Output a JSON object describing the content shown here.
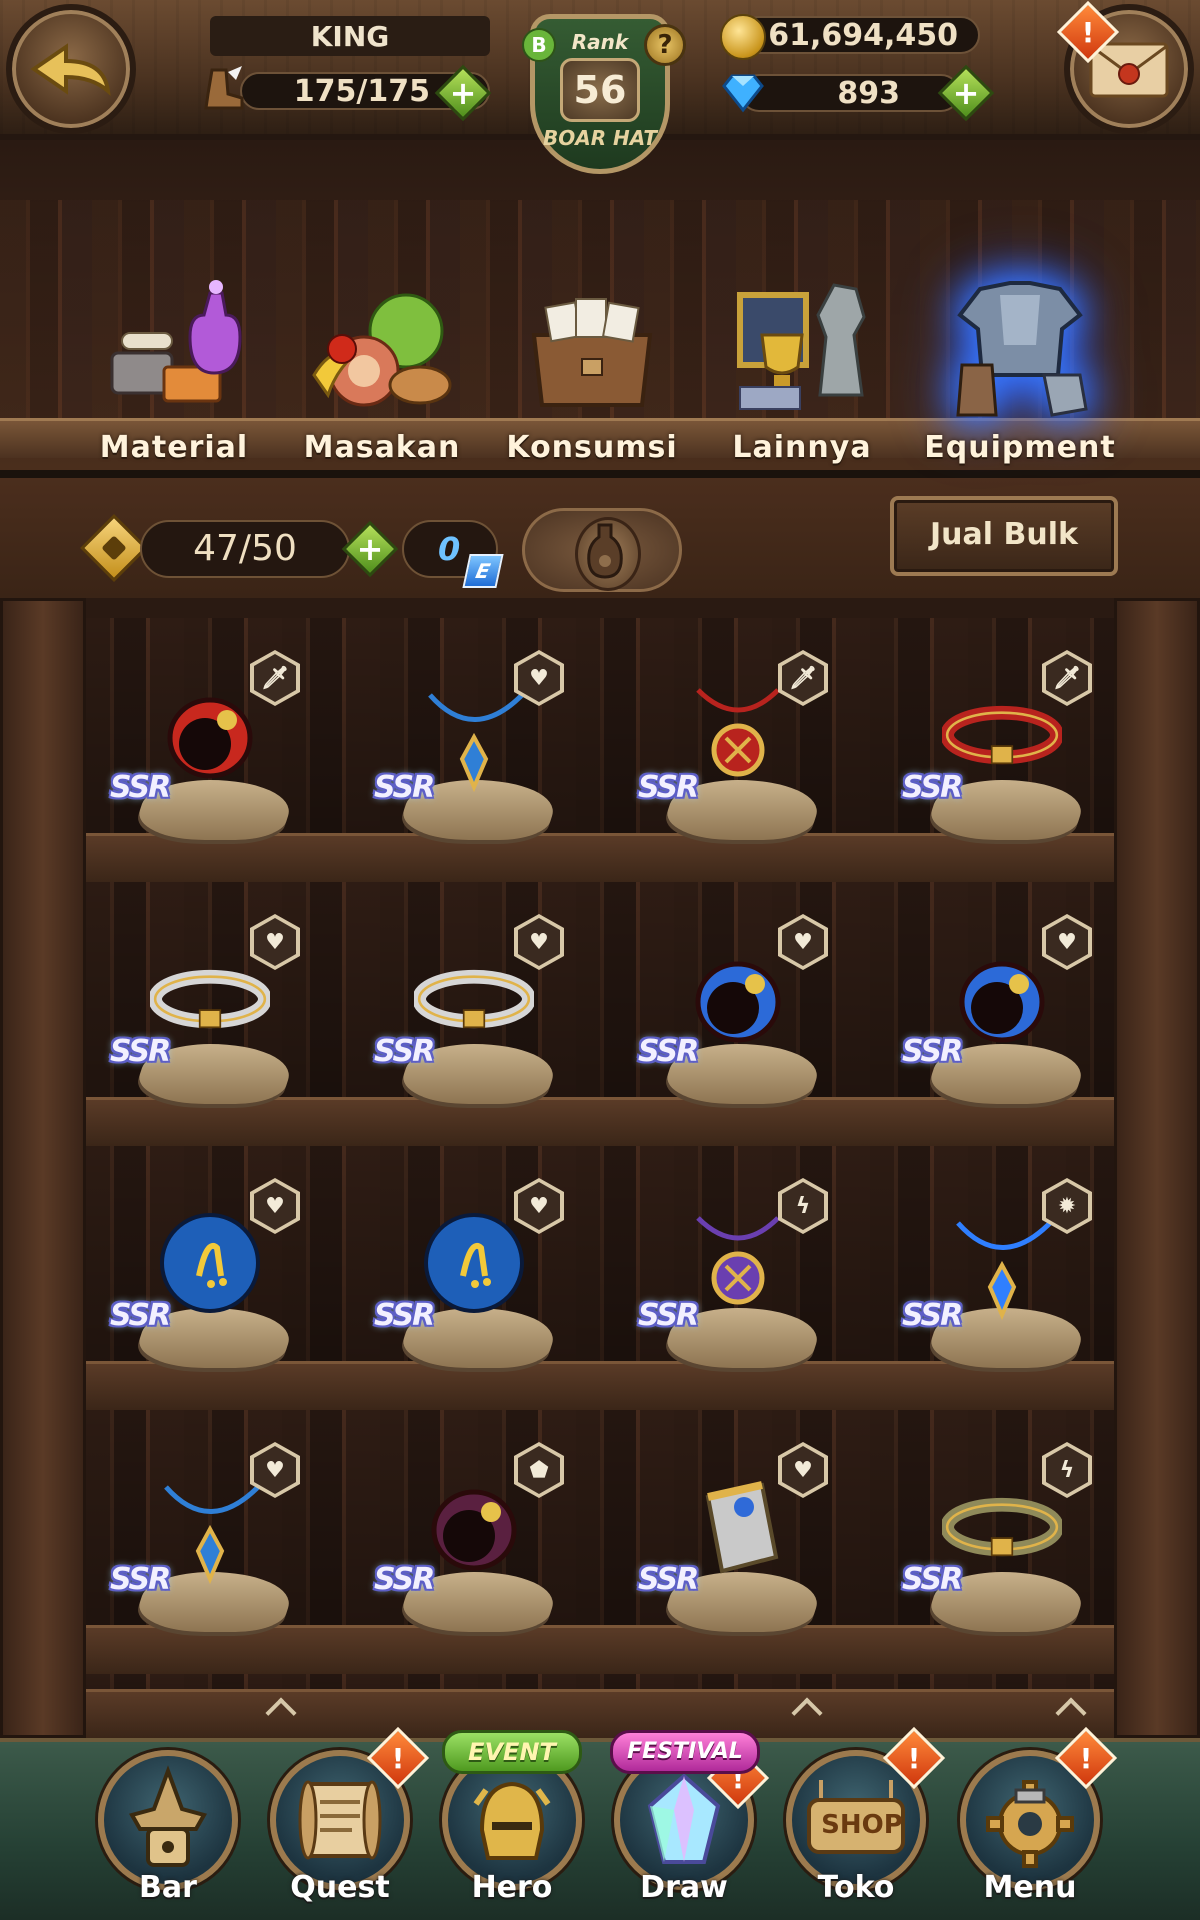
{
  "header": {
    "player_name": "KING",
    "stamina": "175/175",
    "rank_label": "Rank",
    "rank_number": "56",
    "rank_title": "BOAR HAT",
    "rank_letter": "B",
    "help_symbol": "?",
    "gold": "61,694,450",
    "gems": "893",
    "plus_symbol": "+",
    "alert_symbol": "!"
  },
  "categories": [
    {
      "label": "Material",
      "icon": "material-icon",
      "active": false
    },
    {
      "label": "Masakan",
      "icon": "food-icon",
      "active": false
    },
    {
      "label": "Konsumsi",
      "icon": "bag-icon",
      "active": false
    },
    {
      "label": "Lainnya",
      "icon": "trophy-icon",
      "active": false
    },
    {
      "label": "Equipment",
      "icon": "armor-icon",
      "active": true
    }
  ],
  "inventory": {
    "capacity": "47/50",
    "energy_value": "0",
    "energy_letter": "E",
    "bulk_sell_label": "Jual Bulk"
  },
  "items": [
    {
      "name": "red ring",
      "rarity": "SSR",
      "fav_icon": "sword-icon",
      "fav_symbol": "🗡",
      "color": "#c8281e"
    },
    {
      "name": "blue necklace",
      "rarity": "SSR",
      "fav_icon": "heart-icon",
      "fav_symbol": "♥",
      "color": "#2f7fd6"
    },
    {
      "name": "red pendant",
      "rarity": "SSR",
      "fav_icon": "sword-icon",
      "fav_symbol": "🗡",
      "color": "#b8231e"
    },
    {
      "name": "red belt",
      "rarity": "SSR",
      "fav_icon": "sword-icon",
      "fav_symbol": "🗡",
      "color": "#b8231e"
    },
    {
      "name": "silver belt",
      "rarity": "SSR",
      "fav_icon": "heart-icon",
      "fav_symbol": "♥",
      "color": "#d6d6d6"
    },
    {
      "name": "silver belt",
      "rarity": "SSR",
      "fav_icon": "heart-icon",
      "fav_symbol": "♥",
      "color": "#d6d6d6"
    },
    {
      "name": "blue earrings",
      "rarity": "SSR",
      "fav_icon": "heart-icon",
      "fav_symbol": "♥",
      "color": "#2c6ad8"
    },
    {
      "name": "blue earrings",
      "rarity": "SSR",
      "fav_icon": "heart-icon",
      "fav_symbol": "♥",
      "color": "#2c6ad8"
    },
    {
      "name": "blue orb",
      "rarity": "SSR",
      "fav_icon": "heart-icon",
      "fav_symbol": "♥",
      "color": "#1e5fb8"
    },
    {
      "name": "blue orb",
      "rarity": "SSR",
      "fav_icon": "heart-icon",
      "fav_symbol": "♥",
      "color": "#1e5fb8"
    },
    {
      "name": "purple pendant",
      "rarity": "SSR",
      "fav_icon": "lightning-icon",
      "fav_symbol": "ϟ",
      "color": "#6a3fb0"
    },
    {
      "name": "blue crystal necklace",
      "rarity": "SSR",
      "fav_icon": "gear-icon",
      "fav_symbol": "✹",
      "color": "#2f7fff"
    },
    {
      "name": "blue necklace",
      "rarity": "SSR",
      "fav_icon": "heart-icon",
      "fav_symbol": "♥",
      "color": "#2f7fd6"
    },
    {
      "name": "dark ring",
      "rarity": "SSR",
      "fav_icon": "shield-icon",
      "fav_symbol": "⬟",
      "color": "#5a2040"
    },
    {
      "name": "silver bracer",
      "rarity": "SSR",
      "fav_icon": "heart-icon",
      "fav_symbol": "♥",
      "color": "#c9c9c9"
    },
    {
      "name": "gold belt",
      "rarity": "SSR",
      "fav_icon": "lightning-icon",
      "fav_symbol": "ϟ",
      "color": "#8f8a5a"
    }
  ],
  "nav": [
    {
      "label": "Bar",
      "icon": "boar-hat-icon",
      "alert": false
    },
    {
      "label": "Quest",
      "icon": "scroll-icon",
      "alert": true
    },
    {
      "label": "Hero",
      "icon": "helmet-icon",
      "alert": false,
      "ribbon": "EVENT"
    },
    {
      "label": "Draw",
      "icon": "crystal-icon",
      "alert": true,
      "ribbon": "FESTIVAL"
    },
    {
      "label": "Toko",
      "icon": "shop-icon",
      "alert": true,
      "sign": "SHOP"
    },
    {
      "label": "Menu",
      "icon": "gear-hammer-icon",
      "alert": true
    }
  ],
  "colors": {
    "accent_green": "#6ab92e",
    "alert_orange": "#e8561a",
    "equipment_glow": "#3b7dff"
  }
}
